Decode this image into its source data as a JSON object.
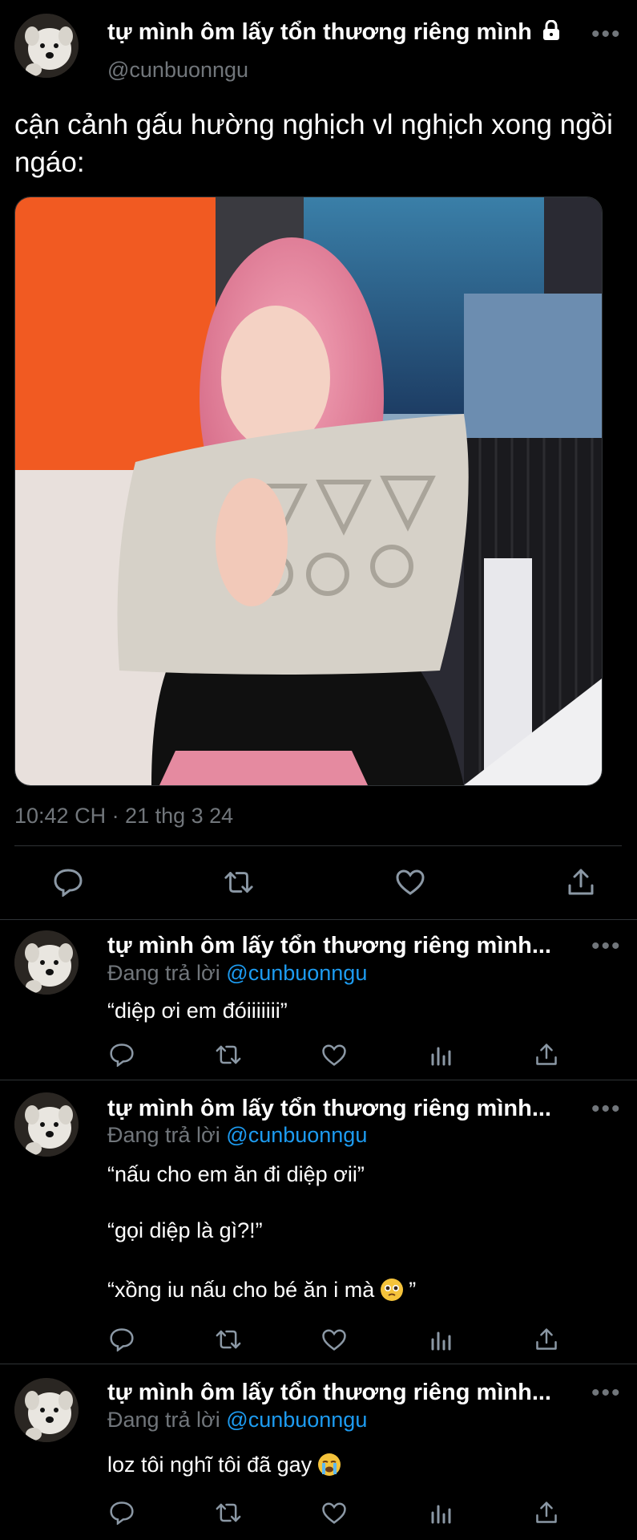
{
  "main_tweet": {
    "author_name": "tự mình ôm lấy tổn thương riêng mình",
    "handle": "@cunbuonngu",
    "text": "cận cảnh gấu hường nghịch vl nghịch xong ngồi ngáo:",
    "timestamp": "10:42 CH · 21 thg 3 24"
  },
  "replies": [
    {
      "author_name": "tự mình ôm lấy tổn thương riêng mình...",
      "replying_prefix": "Đang trả lời",
      "replying_mention": "@cunbuonngu",
      "lines": [
        "“diệp ơi em đóiiiiiii”"
      ]
    },
    {
      "author_name": "tự mình ôm lấy tổn thương riêng mình...",
      "replying_prefix": "Đang trả lời",
      "replying_mention": "@cunbuonngu",
      "lines": [
        "“nấu cho em ăn đi diệp ơii”",
        "“gọi diệp là gì?!”",
        "“xồng iu nấu cho bé ăn i mà",
        "”"
      ]
    },
    {
      "author_name": "tự mình ôm lấy tổn thương riêng mình...",
      "replying_prefix": "Đang trả lời",
      "replying_mention": "@cunbuonngu",
      "lines": [
        "loz tôi nghĩ tôi đã gay"
      ]
    }
  ],
  "icons": {
    "reply": "reply-icon",
    "retweet": "retweet-icon",
    "like": "heart-icon",
    "views": "views-icon",
    "share": "share-icon",
    "more": "more-icon",
    "lock": "lock-icon",
    "pleading": "pleading-face-emoji",
    "crying": "crying-face-emoji"
  },
  "colors": {
    "background": "#000000",
    "text": "#ffffff",
    "secondary": "#71767b",
    "link": "#1d9bf0",
    "divider": "#2f3336"
  }
}
